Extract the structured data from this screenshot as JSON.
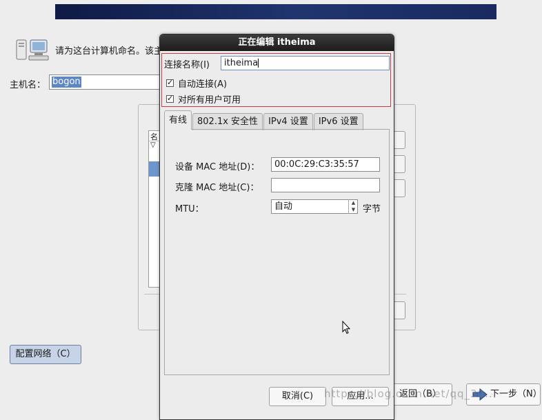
{
  "installer": {
    "intro_text": "请为这台计算机命名。该主",
    "hostname_label": "主机名：",
    "hostname_value": "bogon",
    "list_header": "名",
    "list_collapse_glyph": "▽",
    "configure_network_label": "配置网络（C）",
    "back_label": "返回（B）",
    "next_label": "下一步（N）"
  },
  "dialog": {
    "title": "正在编辑 itheima",
    "connection_name_label": "连接名称(I)",
    "connection_name_value": "itheima",
    "auto_connect_label": "自动连接(A)",
    "all_users_label": "对所有用户可用",
    "tabs": [
      {
        "label": "有线"
      },
      {
        "label": "802.1x 安全性"
      },
      {
        "label": "IPv4 设置"
      },
      {
        "label": "IPv6 设置"
      }
    ],
    "device_mac_label": "设备 MAC 地址(D)：",
    "device_mac_value": "00:0C:29:C3:35:57",
    "cloned_mac_label": "克隆 MAC 地址(C)：",
    "cloned_mac_value": "",
    "mtu_label": "MTU：",
    "mtu_value": "自动",
    "mtu_unit": "字节",
    "cancel_label": "取消(C)",
    "apply_label": "应用..."
  },
  "watermark": "https://blog.csdn.net/qq_30..."
}
